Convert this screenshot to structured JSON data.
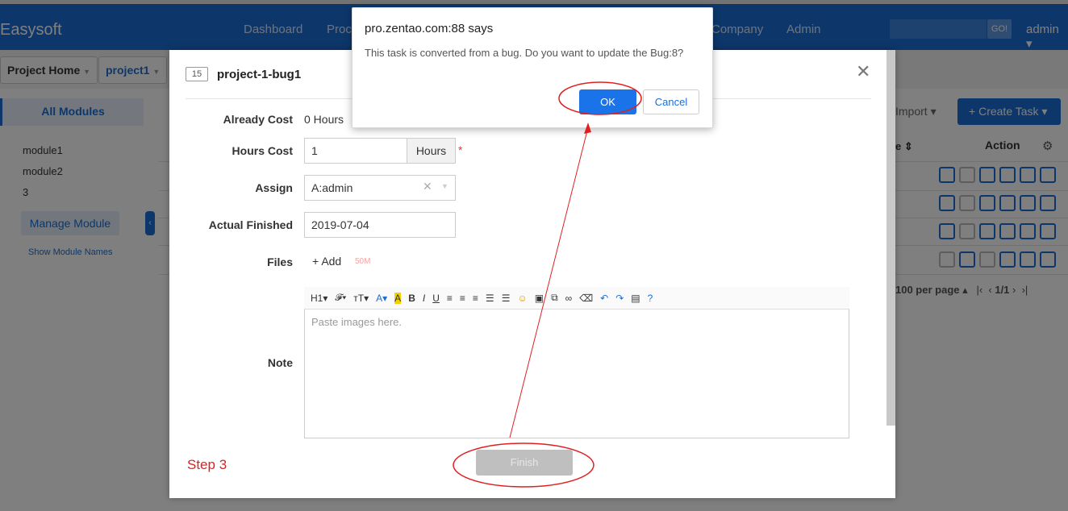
{
  "navbar": {
    "brand": "Easysoft",
    "links": [
      "Dashboard",
      "Proc",
      "Company",
      "Admin"
    ],
    "go_label": "GO!",
    "user": "admin"
  },
  "breadcrumbs": [
    "Project Home",
    "project1"
  ],
  "sidebar": {
    "all_modules": "All Modules",
    "modules": [
      "module1",
      "module2",
      "3"
    ],
    "manage_label": "Manage Module",
    "show_names": "Show Module Names"
  },
  "list": {
    "import_label": "Import",
    "create_label": "Create Task",
    "sort_col": "e",
    "action_col": "Action",
    "pager_text": "100 per page",
    "page_info": "1/1"
  },
  "modal": {
    "task_id": "15",
    "title": "project-1-bug1",
    "fields": {
      "already_cost_label": "Already Cost",
      "already_cost_value": "0 Hours",
      "hours_cost_label": "Hours Cost",
      "hours_cost_value": "1",
      "hours_unit": "Hours",
      "assign_label": "Assign",
      "assign_value": "A:admin",
      "finished_label": "Actual Finished",
      "finished_value": "2019-07-04",
      "files_label": "Files",
      "add_label": "Add",
      "size_hint": "50M",
      "note_label": "Note",
      "note_placeholder": "Paste images here."
    },
    "finish_label": "Finish"
  },
  "alert": {
    "title": "pro.zentao.com:88 says",
    "message": "This task is converted from a bug. Do you want to update the Bug:8?",
    "ok_label": "OK",
    "cancel_label": "Cancel"
  },
  "annotation": {
    "step_label": "Step 3",
    "color": "#e02020"
  },
  "colors": {
    "primary": "#1a6fd6",
    "alert_ok": "#1a73e8"
  }
}
